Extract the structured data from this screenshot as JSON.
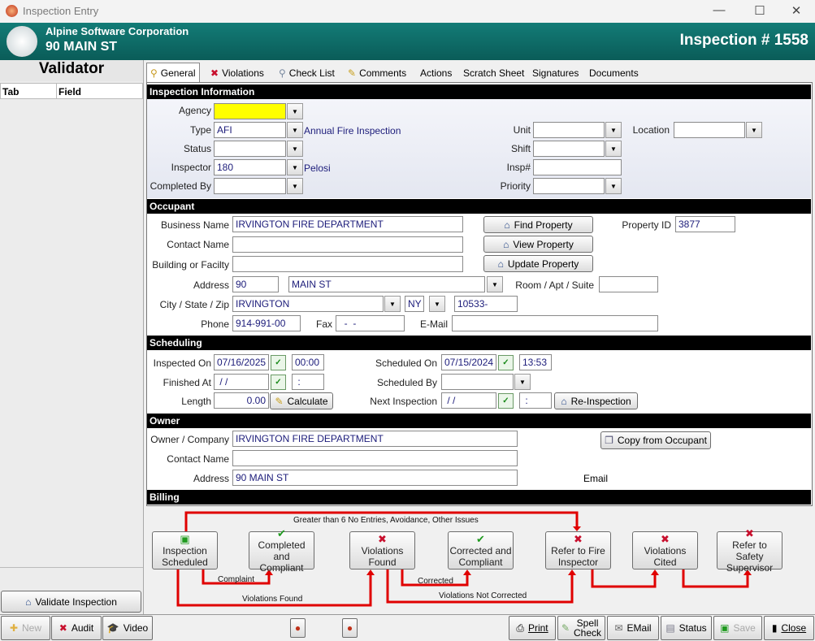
{
  "window": {
    "title": "Inspection Entry",
    "controls": {
      "minimize": "—",
      "maximize": "☐",
      "close": "✕"
    }
  },
  "header": {
    "company": "Alpine Software Corporation",
    "address": "90 MAIN ST",
    "inspection_number": "Inspection # 1558"
  },
  "validator": {
    "title": "Validator",
    "columns": [
      "Tab",
      "Field"
    ],
    "validate_button": "Validate Inspection"
  },
  "tabs": [
    {
      "label": "General",
      "icon": "magnifier-icon"
    },
    {
      "label": "Violations",
      "icon": "red-x-icon"
    },
    {
      "label": "Check List",
      "icon": "checklist-icon"
    },
    {
      "label": "Comments",
      "icon": "pencil-icon"
    },
    {
      "label": "Actions"
    },
    {
      "label": "Scratch Sheet"
    },
    {
      "label": "Signatures"
    },
    {
      "label": "Documents"
    }
  ],
  "inspection_info": {
    "title": "Inspection Information",
    "agency": {
      "label": "Agency",
      "value": ""
    },
    "type": {
      "label": "Type",
      "value": "AFI",
      "description": "Annual Fire Inspection"
    },
    "status": {
      "label": "Status",
      "value": ""
    },
    "inspector": {
      "label": "Inspector",
      "value": "180",
      "name": "Pelosi"
    },
    "completed_by": {
      "label": "Completed By",
      "value": ""
    },
    "unit": {
      "label": "Unit",
      "value": ""
    },
    "location": {
      "label": "Location",
      "value": ""
    },
    "shift": {
      "label": "Shift",
      "value": ""
    },
    "insp_num": {
      "label": "Insp#",
      "value": ""
    },
    "priority": {
      "label": "Priority",
      "value": ""
    },
    "agency_highlight": "#ffff00"
  },
  "occupant": {
    "title": "Occupant",
    "business_name": {
      "label": "Business Name",
      "value": "IRVINGTON FIRE DEPARTMENT"
    },
    "contact_name": {
      "label": "Contact Name",
      "value": ""
    },
    "building": {
      "label": "Building or Facilty",
      "value": ""
    },
    "address": {
      "label": "Address",
      "number": "90",
      "street": "MAIN ST"
    },
    "room": {
      "label": "Room / Apt / Suite",
      "value": ""
    },
    "city_state_zip": {
      "label": "City / State / Zip",
      "city": "IRVINGTON",
      "state": "NY",
      "zip": "10533-"
    },
    "phone": {
      "label": "Phone",
      "value": "914-991-00"
    },
    "fax": {
      "label": "Fax",
      "value": "  -  -"
    },
    "email": {
      "label": "E-Mail",
      "value": ""
    },
    "property_id": {
      "label": "Property ID",
      "value": "3877"
    },
    "find_property": "Find Property",
    "view_property": "View Property",
    "update_property": "Update Property"
  },
  "scheduling": {
    "title": "Scheduling",
    "inspected_on": {
      "label": "Inspected On",
      "date": "07/16/2025",
      "time": "00:00"
    },
    "finished_at": {
      "label": "Finished At",
      "date": " / /",
      "time": " :"
    },
    "length": {
      "label": "Length",
      "value": "0.00"
    },
    "calculate": "Calculate",
    "scheduled_on": {
      "label": "Scheduled On",
      "date": "07/15/2024",
      "time": "13:53"
    },
    "scheduled_by": {
      "label": "Scheduled By",
      "value": ""
    },
    "next_inspection": {
      "label": "Next Inspection",
      "date": " / /",
      "time": " :"
    },
    "reinspection": "Re-Inspection"
  },
  "owner": {
    "title": "Owner",
    "company": {
      "label": "Owner / Company",
      "value": "IRVINGTON FIRE DEPARTMENT"
    },
    "contact_name": {
      "label": "Contact Name",
      "value": ""
    },
    "address": {
      "label": "Address",
      "value": "90 MAIN ST"
    },
    "copy_from_occupant": "Copy from Occupant",
    "email_label": "Email"
  },
  "billing": {
    "title": "Billing"
  },
  "workflow": {
    "steps": [
      {
        "label1": "Inspection",
        "label2": "Scheduled",
        "icon": "calendar-icon"
      },
      {
        "label1": "Completed and",
        "label2": "Compliant",
        "icon": "checkmark-icon"
      },
      {
        "label1": "Violations",
        "label2": "Found",
        "icon": "red-x-icon"
      },
      {
        "label1": "Corrected and",
        "label2": "Compliant",
        "icon": "checkmark-icon"
      },
      {
        "label1": "Refer to Fire",
        "label2": "Inspector",
        "icon": "red-x-icon"
      },
      {
        "label1": "Violations Cited",
        "label2": "",
        "icon": "red-x-icon"
      },
      {
        "label1": "Refer to Safety",
        "label2": "Supervisor",
        "icon": "red-x-icon"
      }
    ],
    "transitions": {
      "escalation": "Greater than 6 No Entries, Avoidance, Other Issues",
      "complaint": "Complaint",
      "violations_found": "Violations Found",
      "corrected": "Corrected",
      "not_corrected": "Violations Not Corrected"
    },
    "arrow_color": "#e00000"
  },
  "toolbar": {
    "new": "New",
    "audit": "Audit",
    "video": "Video",
    "print": "Print",
    "spell1": "Spell",
    "spell2": "Check",
    "email": "EMail",
    "status": "Status",
    "save": "Save",
    "close": "Close"
  }
}
